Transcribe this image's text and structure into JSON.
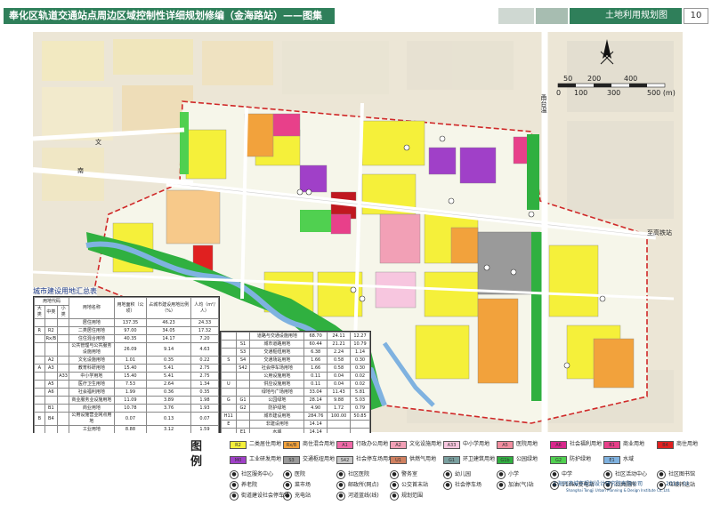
{
  "header": {
    "title": "奉化区轨道交通站点周边区域控制性详细规划修编（金海路站）——图集",
    "sheet_title": "土地利用规划图",
    "page_number": "10"
  },
  "map": {
    "scale_labels": [
      "50",
      "200",
      "400",
      "0",
      "100",
      "300",
      "500 (m)"
    ],
    "labels": {
      "station": "至高铁站",
      "road_vertical": "甬台温",
      "road_top": "文",
      "road_left": "南"
    }
  },
  "stats_table": {
    "title": "城市建设用地汇总表",
    "headers": [
      "用地代码",
      "",
      "",
      "用地名称",
      "用地面积（公顷）",
      "占城市建设用地比例（%）",
      "人均（m²/人）"
    ],
    "subheaders": [
      "大类",
      "中类",
      "小类"
    ],
    "rows": [
      [
        "",
        "",
        "",
        "居住用地",
        "137.35",
        "46.23",
        "24.33"
      ],
      [
        "R",
        "R2",
        "",
        "二类居住用地",
        "97.00",
        "34.05",
        "17.32"
      ],
      [
        "",
        "Rx/B",
        "",
        "住住混合用地",
        "40.35",
        "14.17",
        "7.20"
      ],
      [
        "",
        "",
        "",
        "公共管理与公共服务设施用地",
        "26.09",
        "9.14",
        "4.63"
      ],
      [
        "",
        "A2",
        "",
        "文化设施用地",
        "1.01",
        "0.35",
        "0.22"
      ],
      [
        "A",
        "A3",
        "",
        "教育科研用地",
        "15.40",
        "5.41",
        "2.75"
      ],
      [
        "",
        "",
        "A33",
        "中小学用地",
        "15.40",
        "5.41",
        "2.75"
      ],
      [
        "",
        "A5",
        "",
        "医疗卫生用地",
        "7.53",
        "2.64",
        "1.34"
      ],
      [
        "",
        "A6",
        "",
        "社会福利用地",
        "1.99",
        "0.36",
        "0.35"
      ],
      [
        "",
        "",
        "",
        "商业服务业设施用地",
        "11.09",
        "3.89",
        "1.98"
      ],
      [
        "",
        "B1",
        "",
        "商业用地",
        "10.78",
        "3.76",
        "1.93"
      ],
      [
        "B",
        "B4",
        "",
        "公用设施营业网点用地",
        "0.07",
        "0.13",
        "0.07"
      ],
      [
        "",
        "",
        "",
        "工业用地",
        "8.88",
        "3.12",
        "1.59"
      ],
      [
        "M",
        "M0",
        "",
        "工业研发用地",
        "8.88",
        "3.12",
        "1.59"
      ]
    ]
  },
  "stats_table2": {
    "rows": [
      [
        "",
        "",
        "道路与交通设施用地",
        "68.70",
        "24.11",
        "12.27"
      ],
      [
        "",
        "S1",
        "城市道路用地",
        "60.44",
        "21.21",
        "10.79"
      ],
      [
        "",
        "S3",
        "交通枢纽用地",
        "6.38",
        "2.24",
        "1.14"
      ],
      [
        "S",
        "S4",
        "交通场站用地",
        "1.66",
        "0.58",
        "0.30"
      ],
      [
        "",
        "S42",
        "社会停车场用地",
        "1.66",
        "0.58",
        "0.30"
      ],
      [
        "",
        "",
        "公用设施用地",
        "0.11",
        "0.04",
        "0.02"
      ],
      [
        "U",
        "",
        "供应设施用地",
        "0.11",
        "0.04",
        "0.02"
      ],
      [
        "",
        "",
        "绿地与广场用地",
        "33.04",
        "11.43",
        "5.81"
      ],
      [
        "G",
        "G1",
        "公园绿地",
        "28.14",
        "9.88",
        "5.03"
      ],
      [
        "",
        "G2",
        "防护绿地",
        "4.90",
        "1.72",
        "0.79"
      ],
      [
        "H11",
        "",
        "城市建设用地",
        "284.76",
        "100.00",
        "50.85"
      ],
      [
        "E",
        "",
        "非建设用地",
        "14.14",
        "",
        ""
      ],
      [
        "",
        "E1",
        "水域",
        "14.14",
        "",
        ""
      ],
      [
        "",
        "",
        "城市用地",
        "298.90",
        "",
        ""
      ]
    ]
  },
  "legend": {
    "title": "图例",
    "items": [
      {
        "code": "R2",
        "label": "二类居住用地",
        "color": "#f5f03a"
      },
      {
        "code": "Rx/B",
        "label": "商住混合用地",
        "color": "#f2a23c"
      },
      {
        "code": "A1",
        "label": "行政办公用地",
        "color": "#f06aa8"
      },
      {
        "code": "A2",
        "label": "文化设施用地",
        "color": "#f2a0b6"
      },
      {
        "code": "A33",
        "label": "中小学用地",
        "color": "#f7c6df"
      },
      {
        "code": "A5",
        "label": "医院用地",
        "color": "#f28ea0"
      },
      {
        "code": "A6",
        "label": "社会福利用地",
        "color": "#d8288c"
      },
      {
        "code": "B1",
        "label": "商业用地",
        "color": "#e8408a"
      },
      {
        "code": "B4",
        "label": "商住用地",
        "color": "#e02020"
      },
      {
        "code": "M0",
        "label": "工业研发用地",
        "color": "#a040c8"
      },
      {
        "code": "S3",
        "label": "交通枢纽用地",
        "color": "#9a9a9a"
      },
      {
        "code": "S42",
        "label": "社会停车场用地",
        "color": "#c8c8c8"
      },
      {
        "code": "U1",
        "label": "供燃气用地",
        "color": "#d08060"
      },
      {
        "code": "G1",
        "label": "环卫建筑用地",
        "color": "#7aa0a0"
      },
      {
        "code": "G1b",
        "label": "公园绿地",
        "color": "#30b040"
      },
      {
        "code": "G2",
        "label": "防护绿地",
        "color": "#50d050"
      },
      {
        "code": "E1",
        "label": "水域",
        "color": "#7fb2e0"
      }
    ],
    "icons": [
      "社区服务中心",
      "医院",
      "社区医院",
      "警务室",
      "幼儿园",
      "小学",
      "中学",
      "社区活动中心",
      "社区图书馆",
      "养老院",
      "菜市场",
      "邮政所(网点)",
      "公交首末站",
      "社会停车场",
      "加油(气)站",
      "110kv变电站",
      "公共厕所",
      "垃圾转运站",
      "街道建设社会停车场",
      "充电站",
      "河道蓝线(线)",
      "规划范围"
    ]
  },
  "organization": {
    "name": "上海同济城市规划设计研究院有限公司",
    "name_en": "Shanghai Tongji Urban Planning & Design Institute Co.,Ltd.",
    "date": "2018. 01"
  }
}
